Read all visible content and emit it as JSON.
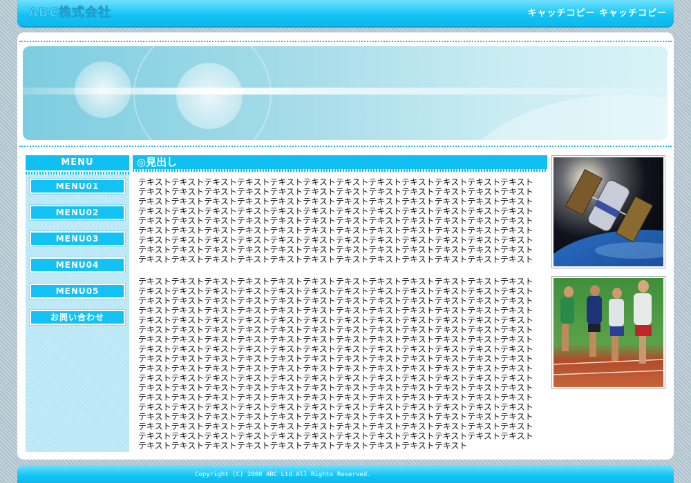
{
  "header": {
    "logo": "ABC株式会社",
    "catch_copy": "キャッチコピー キャッチコピー"
  },
  "sidebar": {
    "title": "MENU",
    "items": [
      {
        "label": "MENU01"
      },
      {
        "label": "MENU02"
      },
      {
        "label": "MENU03"
      },
      {
        "label": "MENU04"
      },
      {
        "label": "MENU05"
      },
      {
        "label": "お問い合わせ"
      }
    ]
  },
  "content": {
    "heading": "◎見出し",
    "paragraph1": "テキストテキストテキストテキストテキストテキストテキストテキストテキストテキストテキストテキストテキストテキストテキストテキストテキストテキストテキストテキストテキストテキストテキストテキストテキストテキストテキストテキストテキストテキストテキストテキストテキストテキストテキストテキストテキストテキストテキストテキストテキストテキストテキストテキストテキストテキストテキストテキストテキストテキストテキストテキストテキストテキストテキストテキストテキストテキストテキストテキストテキストテキストテキストテキストテキストテキストテキストテキストテキストテキストテキストテキストテキストテキストテキストテキストテキストテキストテキストテキストテキストテキストテキストテキストテキストテキストテキストテキストテキストテキストテキストテキストテキストテキストテキストテキストテキストテキストテキストテキストテキストテキストテキストテキストテキストテキストテキストテキスト",
    "paragraph2": "テキストテキストテキストテキストテキストテキストテキストテキストテキストテキストテキストテキストテキストテキストテキストテキストテキストテキストテキストテキストテキストテキストテキストテキストテキストテキストテキストテキストテキストテキストテキストテキストテキストテキストテキストテキストテキストテキストテキストテキストテキストテキストテキストテキストテキストテキストテキストテキストテキストテキストテキストテキストテキストテキストテキストテキストテキストテキストテキストテキストテキストテキストテキストテキストテキストテキストテキストテキストテキストテキストテキストテキストテキストテキストテキストテキストテキストテキストテキストテキストテキストテキストテキストテキストテキストテキストテキストテキストテキストテキストテキストテキストテキストテキストテキストテキストテキストテキストテキストテキストテキストテキストテキストテキストテキストテキストテキストテキストテキストテキストテキストテキストテキストテキストテキストテキストテキストテキストテキストテキストテキストテキストテキストテキストテキストテキストテキストテキストテキストテキストテキストテキストテキストテキストテキストテキストテキストテキストテキストテキストテキストテキストテキストテキストテキストテキストテキストテキストテキストテキストテキストテキストテキストテキストテキストテキストテキストテキストテキストテキストテキストテキストテキストテキストテキストテキストテキストテキストテキストテキストテキストテキストテキストテキストテキストテキストテキストテキストテキストテキストテキストテキストテキストテキストテキストテキストテキストテキストテキストテキストテキストテキストテキストテキストテキストテキストテキストテキストテキストテキストテキストテキストテキストテキストテキストテキストテキストテキストテキストテキストテキストテキストテキストテキスト"
  },
  "images": {
    "photo1_icon": "satellite-photo",
    "photo2_icon": "runners-photo"
  },
  "footer": {
    "copyright": "Copyright (C) 2008 ABC Ltd.All Rights Reserved."
  },
  "colors": {
    "accent": "#10c0f2",
    "sidebar_bg": "#bfeaf8",
    "dots": "#1ab8e8"
  }
}
